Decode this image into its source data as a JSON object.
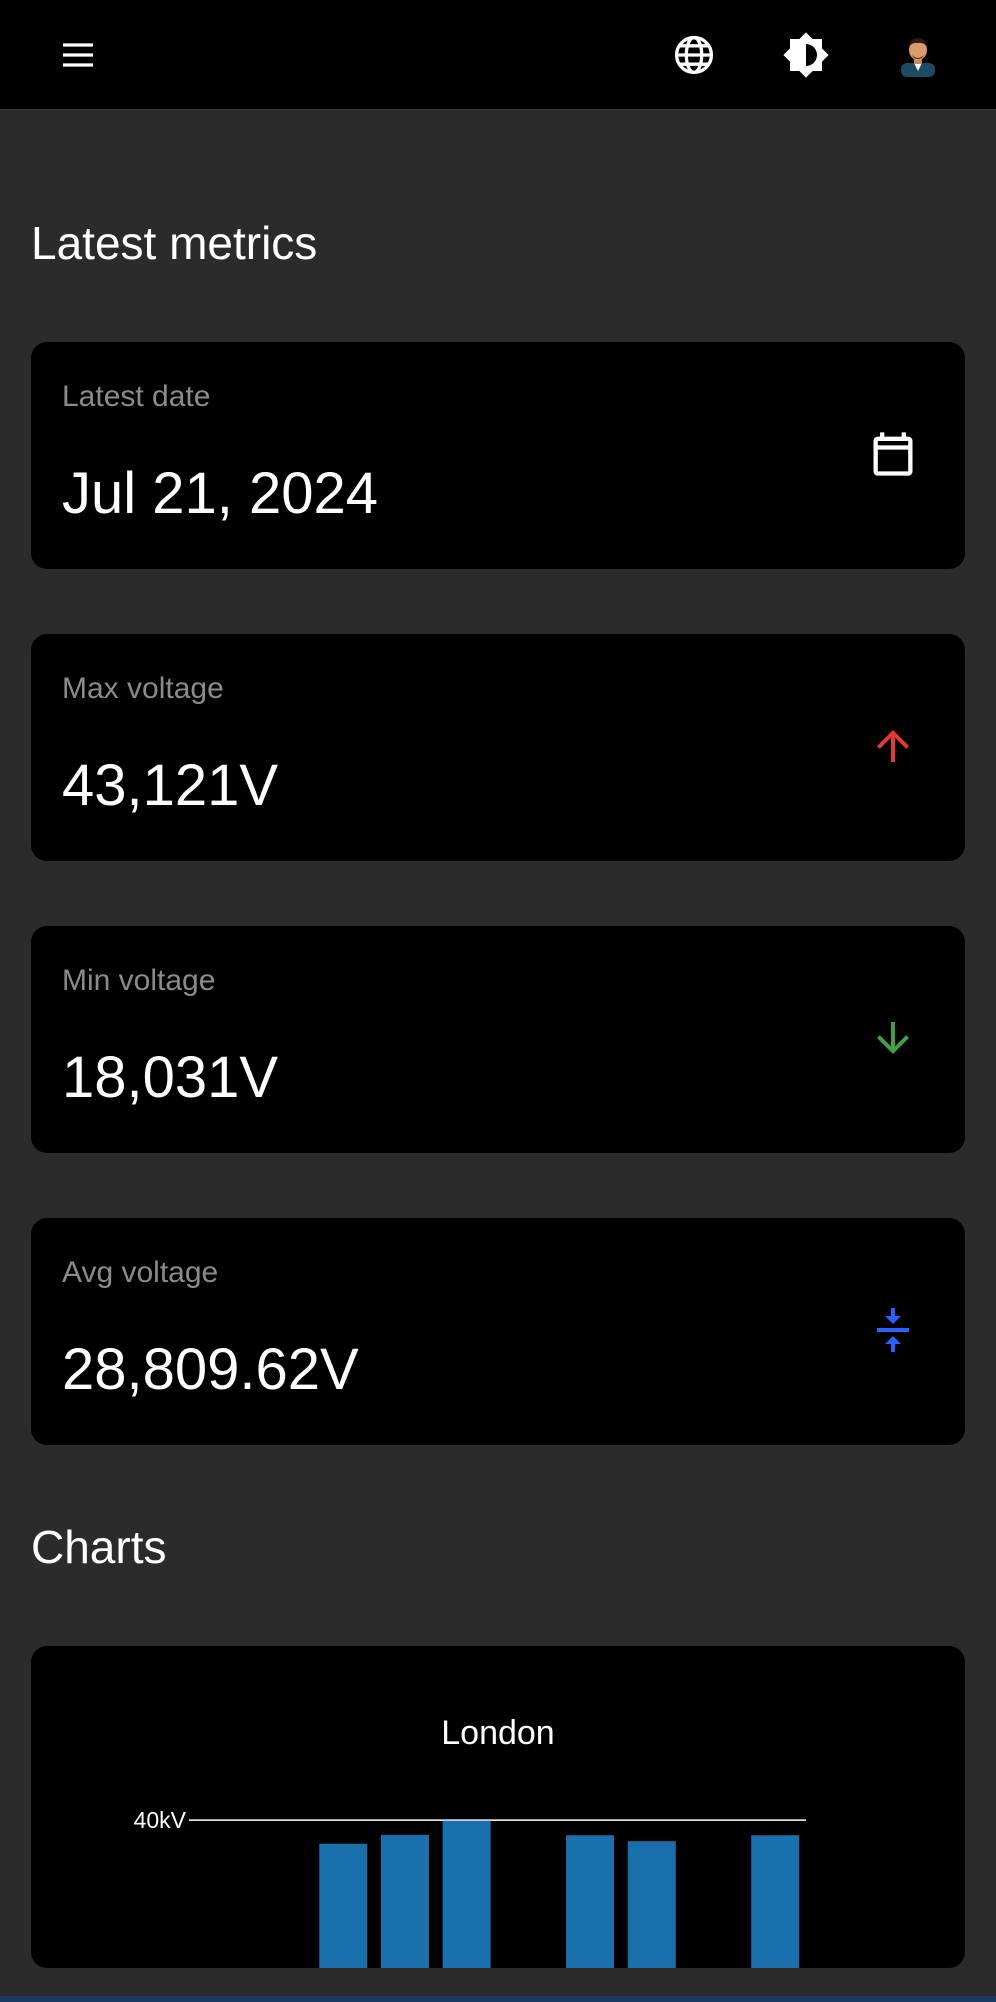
{
  "appbar": {
    "menu_icon": "menu-icon",
    "language_icon": "globe-icon",
    "theme_icon": "brightness-icon",
    "avatar_icon": "avatar"
  },
  "metrics_section": {
    "title": "Latest metrics"
  },
  "metrics": [
    {
      "label": "Latest date",
      "value": "Jul 21, 2024",
      "icon": "calendar-icon",
      "icon_color": "#ffffff"
    },
    {
      "label": "Max voltage",
      "value": "43,121V",
      "icon": "arrow-up-icon",
      "icon_color": "#e53935"
    },
    {
      "label": "Min voltage",
      "value": "18,031V",
      "icon": "arrow-down-icon",
      "icon_color": "#43a047"
    },
    {
      "label": "Avg voltage",
      "value": "28,809.62V",
      "icon": "vertical-align-center-icon",
      "icon_color": "#2962ff"
    }
  ],
  "charts_section": {
    "title": "Charts"
  },
  "chart_data": {
    "type": "bar",
    "title": "London",
    "y_tick_labels": [
      "40kV"
    ],
    "y_tick_values": [
      40000
    ],
    "ylim": [
      0,
      43000
    ],
    "bar_color": "#1a6fad",
    "categories": [
      "",
      "",
      "",
      "",
      "",
      "",
      "",
      "",
      "",
      ""
    ],
    "values": [
      null,
      null,
      33600,
      36000,
      39800,
      null,
      35900,
      34300,
      null,
      35900
    ]
  }
}
